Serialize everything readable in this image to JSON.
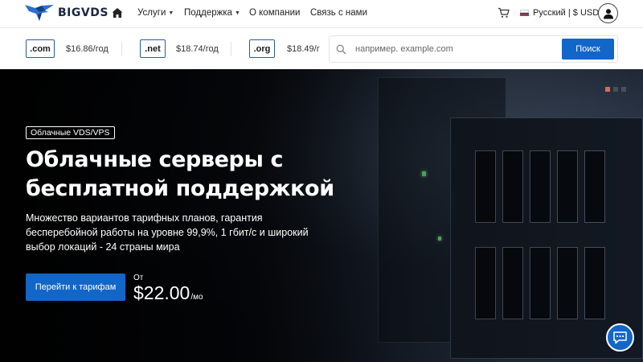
{
  "nav": {
    "logo_text": "BIGVDS",
    "items": [
      {
        "label": "Услуги",
        "has_dropdown": true
      },
      {
        "label": "Поддержка",
        "has_dropdown": true
      },
      {
        "label": "О компании",
        "has_dropdown": false
      },
      {
        "label": "Связь с нами",
        "has_dropdown": false
      }
    ],
    "language_currency": "Русский | $ USD"
  },
  "domains": {
    "tlds": [
      {
        "name": ".com",
        "price": "$16.86/год"
      },
      {
        "name": ".net",
        "price": "$18.74/год"
      },
      {
        "name": ".org",
        "price": "$18.49/г"
      }
    ],
    "search": {
      "placeholder": "например. example.com",
      "button_label": "Поиск"
    }
  },
  "hero": {
    "badge": "Облачные VDS/VPS",
    "headline_line1": "Облачные серверы с",
    "headline_line2": "бесплатной поддержкой",
    "subtext": "Множество вариантов тарифных планов, гарантия бесперебойной работы на уровне 99,9%, 1 гбит/с и широкий выбор локаций - 24 страны мира",
    "cta_label": "Перейти к тарифам",
    "price_prefix": "От",
    "price": "$22.00",
    "price_unit": "/мо",
    "slides_total": 3,
    "slide_active": 1
  },
  "colors": {
    "accent": "#1266c8",
    "tld_border": "#2c5aa0",
    "slide_active": "#e0665a",
    "led": "#62d27a"
  },
  "icons": [
    "logo-eagle-icon",
    "home-icon",
    "cart-icon",
    "russia-flag-icon",
    "user-icon",
    "search-icon",
    "chat-icon"
  ]
}
